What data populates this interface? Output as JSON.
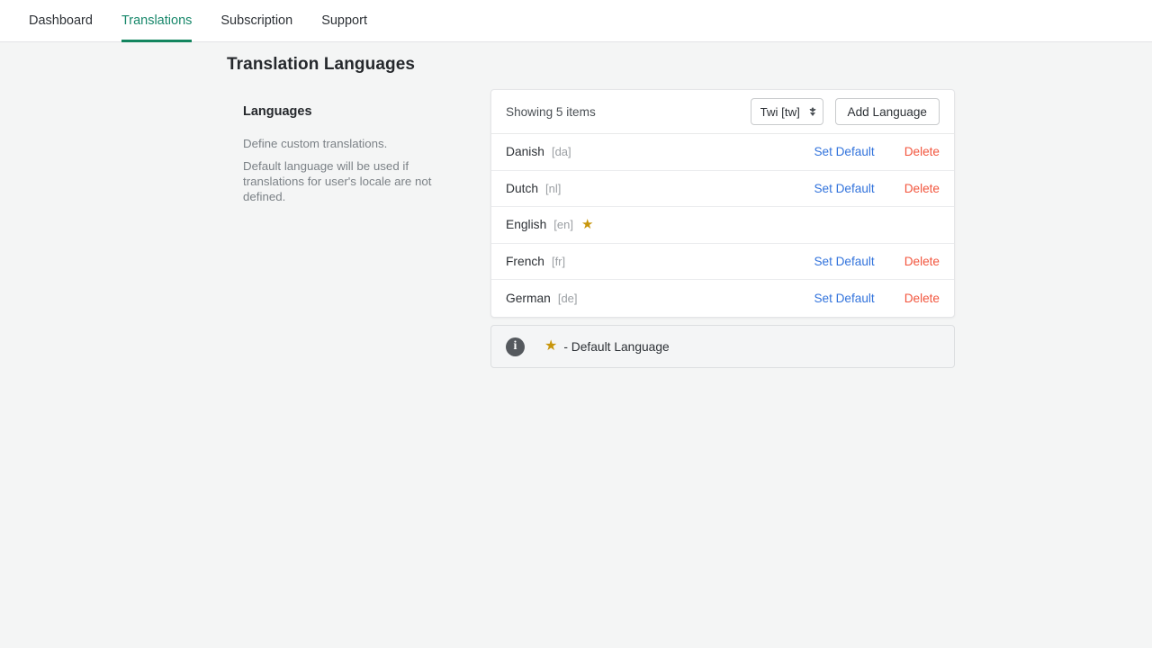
{
  "nav": {
    "items": [
      {
        "label": "Dashboard",
        "active": false
      },
      {
        "label": "Translations",
        "active": true
      },
      {
        "label": "Subscription",
        "active": false
      },
      {
        "label": "Support",
        "active": false
      }
    ]
  },
  "page": {
    "title": "Translation Languages"
  },
  "sidebar": {
    "heading": "Languages",
    "paragraphs": [
      "Define custom translations.",
      "Default language will be used if translations for user's locale are not defined."
    ]
  },
  "card": {
    "showing": "Showing 5 items",
    "select": {
      "value": "Twi [tw]",
      "options": [
        "Twi [tw]"
      ]
    },
    "add_button": "Add Language",
    "actions": {
      "set_default": "Set Default",
      "delete": "Delete"
    },
    "rows": [
      {
        "name": "Danish",
        "code": "[da]",
        "is_default": false
      },
      {
        "name": "Dutch",
        "code": "[nl]",
        "is_default": false
      },
      {
        "name": "English",
        "code": "[en]",
        "is_default": true
      },
      {
        "name": "French",
        "code": "[fr]",
        "is_default": false
      },
      {
        "name": "German",
        "code": "[de]",
        "is_default": false
      }
    ]
  },
  "banner": {
    "info_icon": "info-icon",
    "star_icon": "star-icon",
    "text": "- Default Language"
  },
  "icons": {
    "star": "★",
    "info": "i"
  },
  "colors": {
    "accent": "#13855f",
    "link": "#3273dc",
    "danger": "#f2553d",
    "star": "#c8960c",
    "page_bg": "#f4f5f5"
  }
}
